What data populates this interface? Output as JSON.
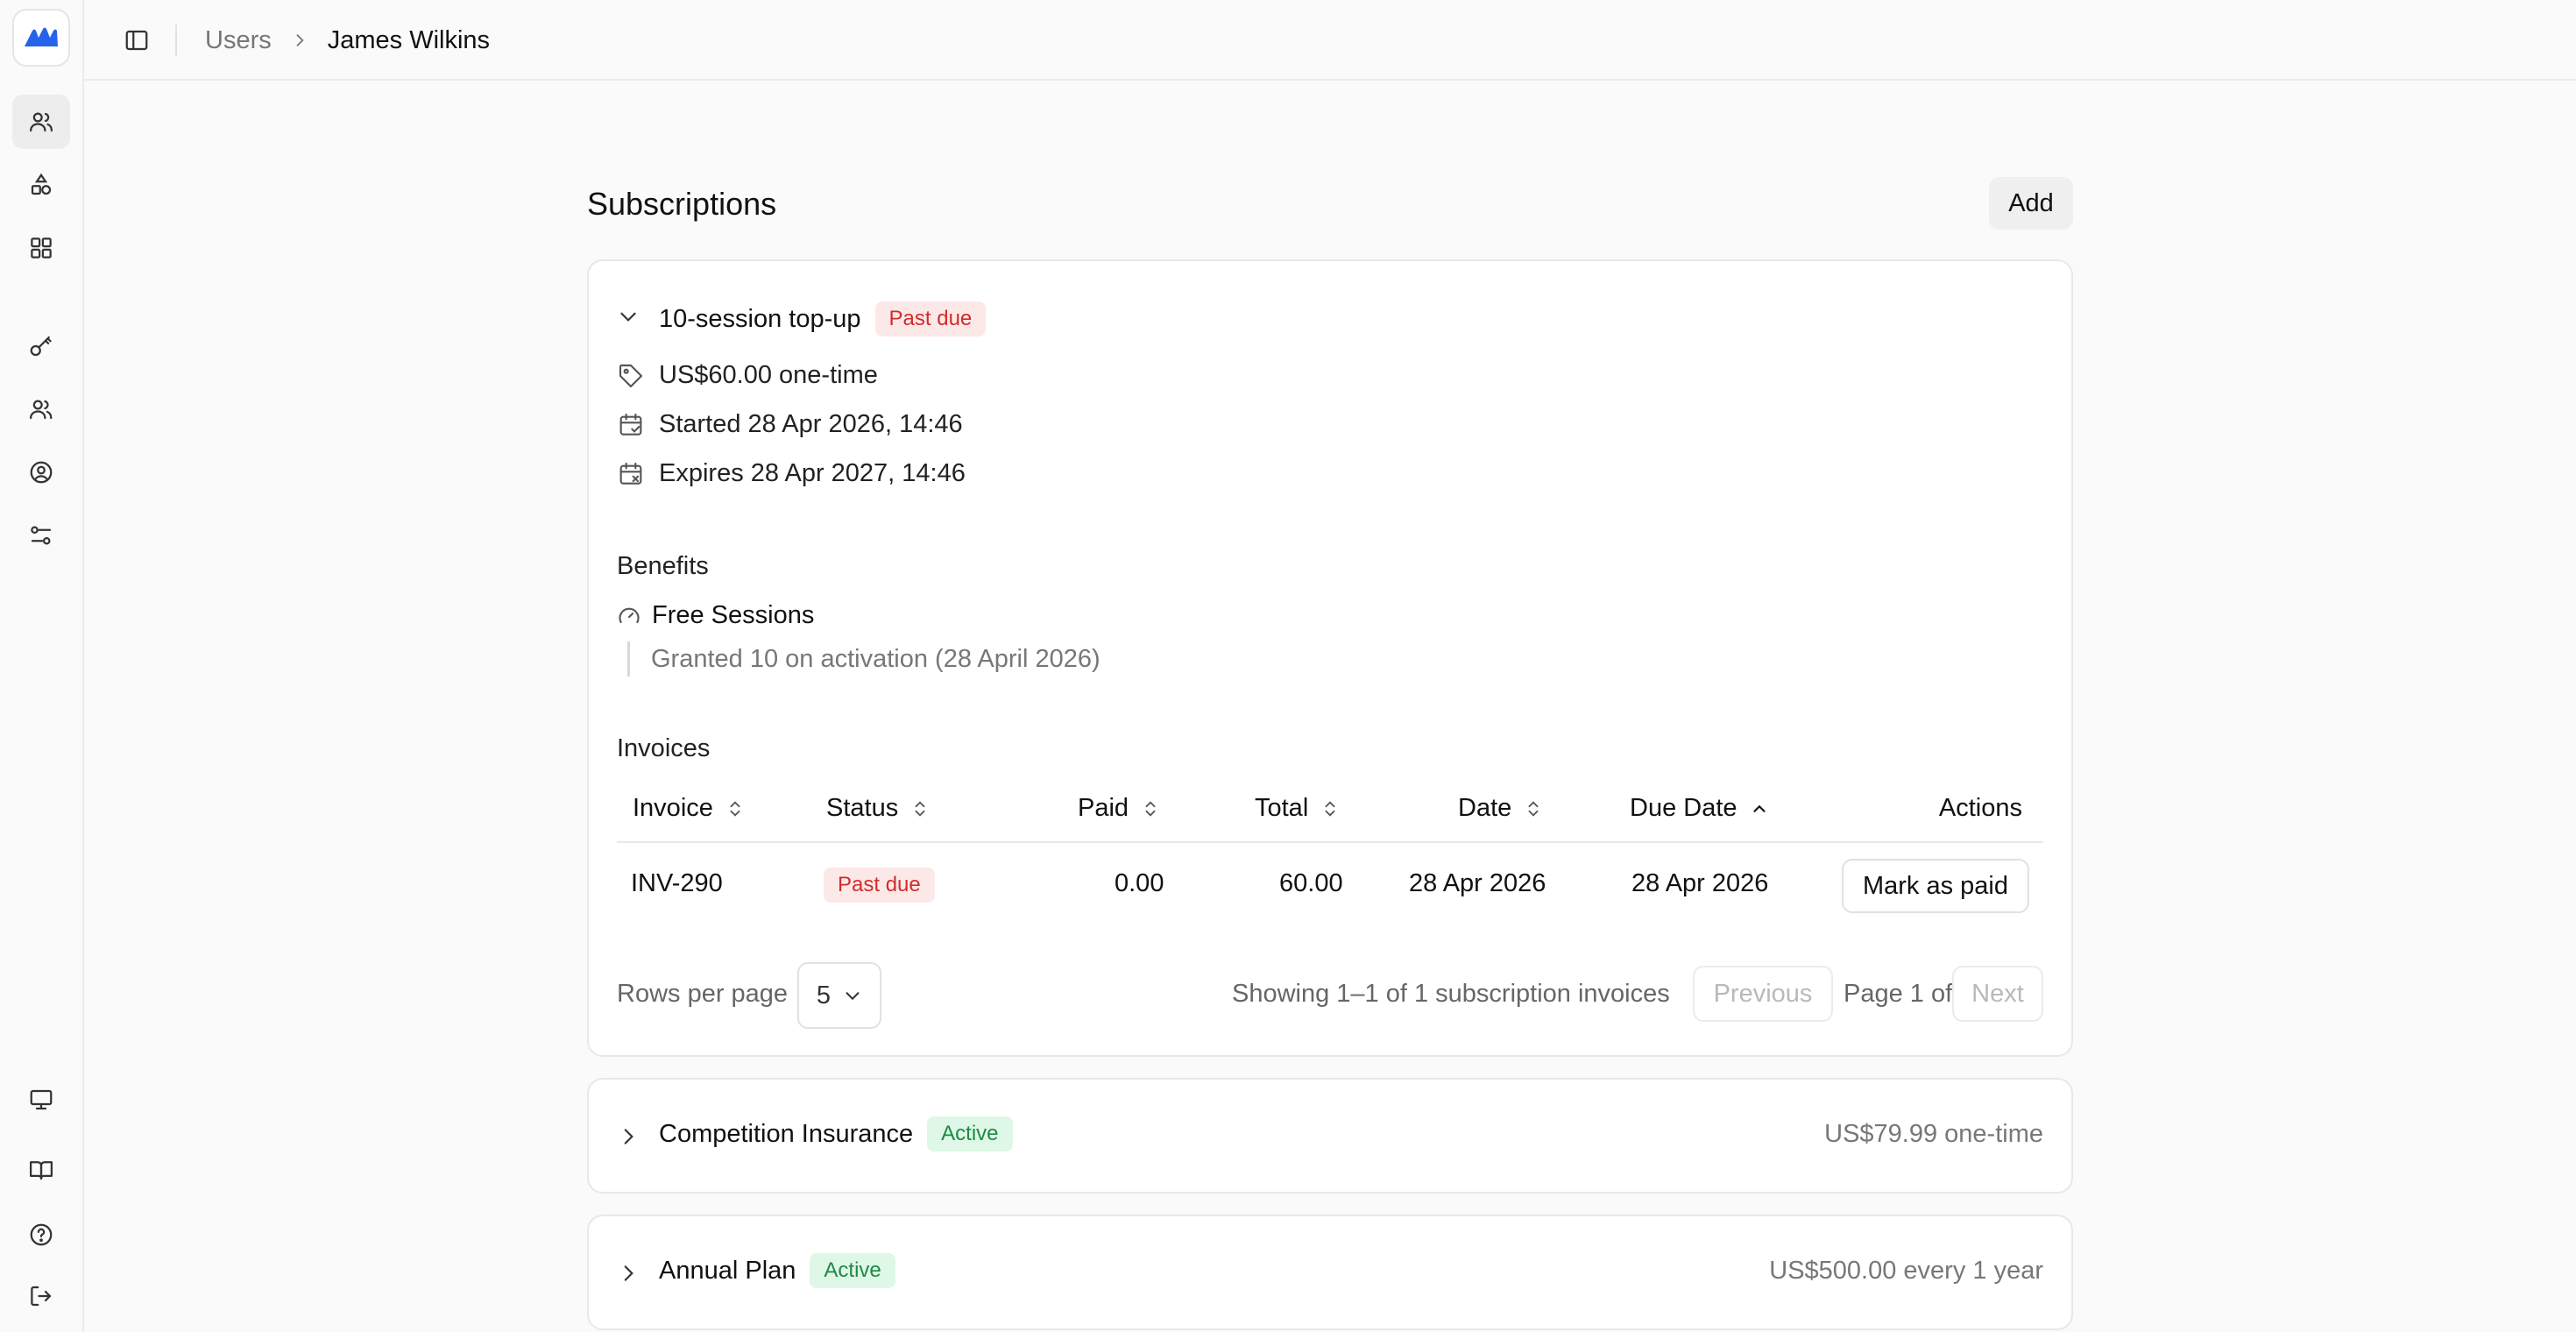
{
  "sidebar": {
    "logo": "brand-logo",
    "nav": [
      {
        "icon": "users-icon",
        "active": true
      },
      {
        "icon": "shapes-icon",
        "active": false
      },
      {
        "icon": "grid-icon",
        "active": false
      },
      {
        "icon": "key-icon",
        "active": false
      },
      {
        "icon": "group-icon",
        "active": false
      },
      {
        "icon": "user-circle-icon",
        "active": false
      },
      {
        "icon": "settings-sliders-icon",
        "active": false
      }
    ],
    "bottom": [
      "monitor-icon",
      "book-icon",
      "help-icon",
      "logout-icon"
    ],
    "accent": "#2563eb"
  },
  "header": {
    "breadcrumb": {
      "parent": "Users",
      "current": "James Wilkins"
    }
  },
  "main": {
    "title": "Subscriptions",
    "add_label": "Add",
    "subscriptions": [
      {
        "name": "10-session top-up",
        "status": "Past due",
        "price": "US$60.00 one-time",
        "started": "Started 28 Apr 2026, 14:46",
        "expires": "Expires 28 Apr 2027, 14:46",
        "benefits_title": "Benefits",
        "benefit_name": "Free Sessions",
        "benefit_note": "Granted 10 on activation (28 April 2026)",
        "invoices_title": "Invoices",
        "columns": [
          "Invoice",
          "Status",
          "Paid",
          "Total",
          "Date",
          "Due Date",
          "Actions"
        ],
        "rows": [
          {
            "invoice": "INV-290",
            "status": "Past due",
            "paid": "0.00",
            "total": "60.00",
            "date": "28 Apr 2026",
            "due": "28 Apr 2026",
            "action": "Mark as paid"
          }
        ],
        "rows_per_page_label": "Rows per page",
        "rows_per_page": "5",
        "showing": "Showing 1–1 of 1 subscription invoices",
        "previous": "Previous",
        "page_info": "Page 1 of 1",
        "next": "Next"
      },
      {
        "name": "Competition Insurance",
        "status": "Active",
        "price": "US$79.99 one-time"
      },
      {
        "name": "Annual Plan",
        "status": "Active",
        "price": "US$500.00 every 1 year"
      }
    ]
  },
  "colors": {
    "past_due_bg": "#fde8e8",
    "past_due_fg": "#d12c2c",
    "active_bg": "#def7e6",
    "active_fg": "#1e8a45"
  }
}
